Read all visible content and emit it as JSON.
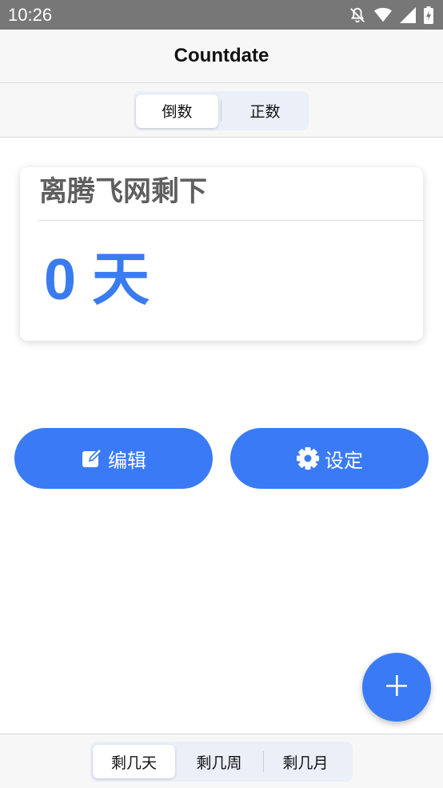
{
  "status_bar": {
    "time": "10:26",
    "icons": [
      "notifications-off-icon",
      "wifi-icon",
      "cell-signal-icon",
      "battery-charging-icon"
    ]
  },
  "app_bar": {
    "title": "Countdate"
  },
  "mode_tabs": {
    "items": [
      {
        "label": "倒数",
        "selected": true
      },
      {
        "label": "正数",
        "selected": false
      }
    ]
  },
  "card": {
    "title": "离腾飞网剩下",
    "value": "0",
    "unit": "天"
  },
  "actions": {
    "edit_label": "编辑",
    "edit_icon": "edit-icon",
    "settings_label": "设定",
    "settings_icon": "gear-icon"
  },
  "fab": {
    "icon": "plus-icon"
  },
  "unit_tabs": {
    "items": [
      {
        "label": "剩几天",
        "selected": true
      },
      {
        "label": "剩几周",
        "selected": false
      },
      {
        "label": "剩几月",
        "selected": false
      }
    ]
  },
  "colors": {
    "accent": "#3a7bf5",
    "status_bar": "#777777",
    "segment_bg": "#eaeff8",
    "title_gray": "#5f5f5f"
  }
}
